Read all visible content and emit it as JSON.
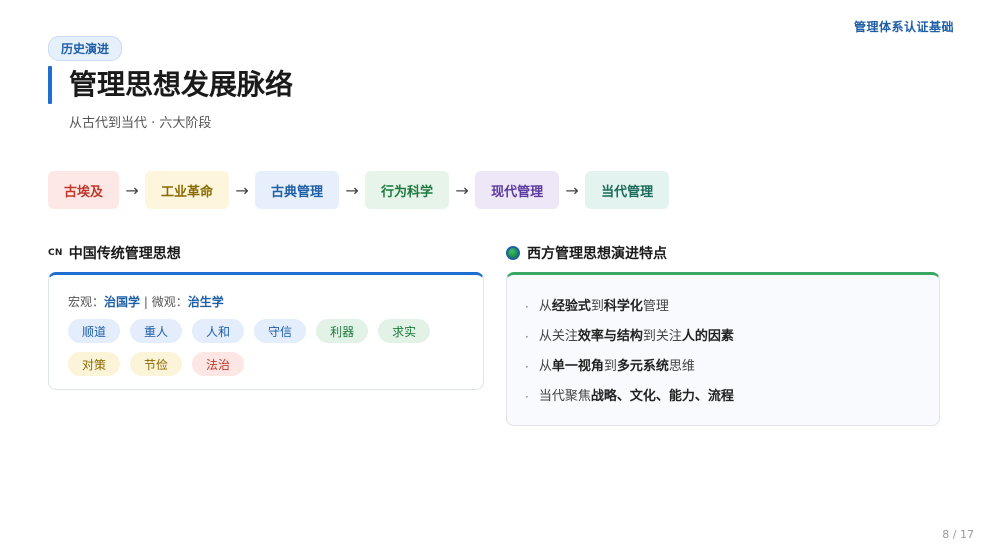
{
  "header": {
    "brand": "管理体系认证基础"
  },
  "tag": "历史演进",
  "title": "管理思想发展脉络",
  "subtitle": "从古代到当代 · 六大阶段",
  "flow": {
    "arrow": "→",
    "stages": [
      {
        "label": "古埃及",
        "bg": "#fde8e6",
        "fg": "#c0392b"
      },
      {
        "label": "工业革命",
        "bg": "#fdf6dc",
        "fg": "#8a6a00"
      },
      {
        "label": "古典管理",
        "bg": "#e6effb",
        "fg": "#1f5fa8"
      },
      {
        "label": "行为科学",
        "bg": "#e6f4ea",
        "fg": "#1e7a3e"
      },
      {
        "label": "现代管理",
        "bg": "#ede7f8",
        "fg": "#5b3aa0"
      },
      {
        "label": "当代管理",
        "bg": "#e3f3ef",
        "fg": "#1b6b5a"
      }
    ]
  },
  "left": {
    "mark": "CN",
    "title": "中国传统管理思想",
    "macro_label": "宏观：",
    "macro_value": "治国学",
    "separator": " | ",
    "micro_label": "微观：",
    "micro_value": "治生学",
    "pills_row1": [
      {
        "label": "顺道",
        "bg": "#e3edfb",
        "fg": "#1f5fa8"
      },
      {
        "label": "重人",
        "bg": "#e3edfb",
        "fg": "#1f5fa8"
      },
      {
        "label": "人和",
        "bg": "#e3edfb",
        "fg": "#1f5fa8"
      },
      {
        "label": "守信",
        "bg": "#e3edfb",
        "fg": "#1f5fa8"
      },
      {
        "label": "利器",
        "bg": "#e2f2e6",
        "fg": "#1e7a3e"
      },
      {
        "label": "求实",
        "bg": "#e2f2e6",
        "fg": "#1e7a3e"
      }
    ],
    "pills_row2": [
      {
        "label": "对策",
        "bg": "#fcf4d8",
        "fg": "#8a6a00"
      },
      {
        "label": "节俭",
        "bg": "#fcf4d8",
        "fg": "#8a6a00"
      },
      {
        "label": "法治",
        "bg": "#fde6e4",
        "fg": "#c0392b"
      }
    ]
  },
  "right": {
    "title": "西方管理思想演进特点",
    "bullet": "·",
    "points": [
      {
        "a": "从",
        "b": "经验式",
        "c": "到",
        "d": "科学化",
        "e": "管理",
        "f": "",
        "g": ""
      },
      {
        "a": "从关注",
        "b": "效率与结构",
        "c": "到关注",
        "d": "人的因素",
        "e": "",
        "f": "",
        "g": ""
      },
      {
        "a": "从",
        "b": "单一视角",
        "c": "到",
        "d": "多元系统",
        "e": "思维",
        "f": "",
        "g": ""
      },
      {
        "a": "当代聚焦",
        "b": "战略、文化、能力、流程",
        "c": "",
        "d": "",
        "e": "",
        "f": "",
        "g": ""
      }
    ]
  },
  "footer": {
    "page": "8 / 17"
  }
}
